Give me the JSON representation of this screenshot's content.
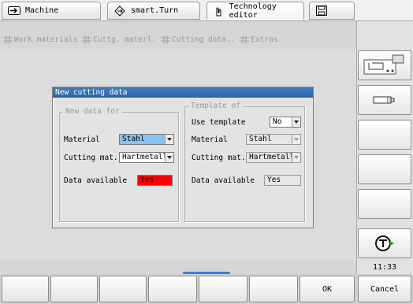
{
  "tabs": [
    {
      "label": "Machine",
      "icon": "arrow-right-icon"
    },
    {
      "label": "smart.Turn",
      "icon": "diamond-arrows-icon"
    },
    {
      "label": "Technology editor",
      "icon": "hand-pointer-icon"
    },
    {
      "label": "",
      "icon": "save-icon"
    }
  ],
  "menu": [
    {
      "label": "Work materials"
    },
    {
      "label": "Cuttg. materl."
    },
    {
      "label": "Cutting data.."
    },
    {
      "label": "Extras"
    }
  ],
  "dialog": {
    "title": "New cutting data",
    "new_data_group": {
      "label": "New data for",
      "material_label": "Material",
      "material_value": "Stahl",
      "cutting_mat_label": "Cutting mat.",
      "cutting_mat_value": "Hartmetall",
      "data_available_label": "Data available",
      "data_available_value": "Yes"
    },
    "template_group": {
      "label": "Template of",
      "use_template_label": "Use template",
      "use_template_value": "No",
      "material_label": "Material",
      "material_value": "Stahl",
      "cutting_mat_label": "Cutting mat.",
      "cutting_mat_value": "Hartmetall",
      "data_available_label": "Data available",
      "data_available_value": "Yes"
    }
  },
  "status": {
    "time": "11:33"
  },
  "softkeys": {
    "ok": "OK",
    "cancel": "Cancel"
  },
  "colors": {
    "title_bar": "#2c63a8",
    "selected_field": "#8cc2ee",
    "alert_field": "#ff0000"
  }
}
